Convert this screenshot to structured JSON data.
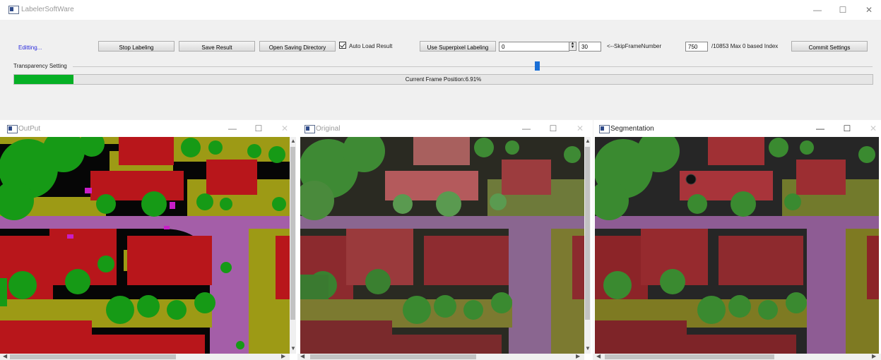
{
  "window": {
    "title": "LabelerSoftWare",
    "minimize_glyph": "—",
    "maximize_glyph": "☐",
    "close_glyph": "✕"
  },
  "toolbar": {
    "status": "Editting...",
    "stop_labeling": "Stop Labeling",
    "save_result": "Save Result",
    "open_saving_directory": "Open Saving Directory",
    "auto_load_label": "Auto Load Result",
    "auto_load_checked": true,
    "use_superpixel": "Use Superpixel Labeling",
    "superpixel_value": "0",
    "skip_frame_value": "30",
    "skip_frame_label": "<--SkipFrameNumber",
    "frame_index_value": "750",
    "max_index_label": "/10853 Max 0 based Index",
    "commit_settings": "Commit Settings"
  },
  "transparency": {
    "label": "Transparency Setting",
    "level_percent": 58
  },
  "progress": {
    "text": "Current Frame Position:6.91%",
    "percent": 6.91
  },
  "panels": [
    {
      "title": "OutPut",
      "minimize_glyph": "—",
      "maximize_glyph": "☐",
      "close_glyph": "✕",
      "active": false
    },
    {
      "title": "Original",
      "minimize_glyph": "—",
      "maximize_glyph": "☐",
      "close_glyph": "✕",
      "active": false
    },
    {
      "title": "Segmentation",
      "minimize_glyph": "—",
      "maximize_glyph": "☐",
      "close_glyph": "✕",
      "active": true
    }
  ],
  "colors": {
    "roof": "#b8161b",
    "tree": "#169a16",
    "shrub": "#9d9a15",
    "road": "#a45ea8",
    "ground": "#060606",
    "car": "#c81ec8",
    "accent_blue": "#1a6fd6",
    "progress_green": "#06b025"
  },
  "icons": {
    "app": "app-window-icon",
    "check": "checkmark-icon",
    "spin": "spin-arrows-icon"
  }
}
